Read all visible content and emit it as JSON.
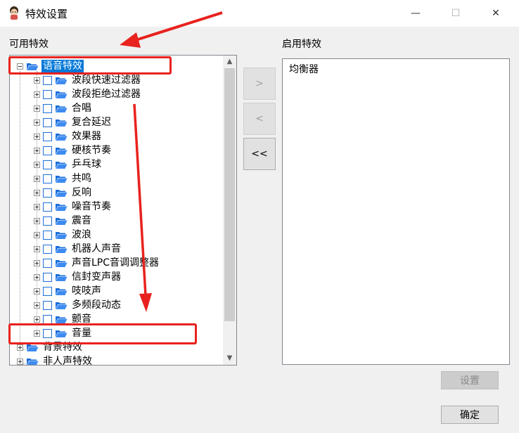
{
  "window": {
    "title": "特效设置",
    "minimize_glyph": "—",
    "maximize_glyph": "☐",
    "close_glyph": "✕"
  },
  "available_panel": {
    "label": "可用特效",
    "tree": {
      "voice_group": {
        "label": "语音特效",
        "children": [
          "波段快速过滤器",
          "波段拒绝过滤器",
          "合唱",
          "复合延迟",
          "效果器",
          "硬核节奏",
          "乒乓球",
          "共鸣",
          "反响",
          "噪音节奏",
          "震音",
          "波浪",
          "机器人声音",
          "声音LPC音调调整器",
          "信封变声器",
          "吱吱声",
          "多频段动态",
          "颤音",
          "音量"
        ]
      },
      "background_group": {
        "label": "背景特效"
      },
      "nonhuman_group": {
        "label": "非人声特效"
      }
    },
    "scroll_up_glyph": "▲",
    "scroll_down_glyph": "▼"
  },
  "transfer_buttons": {
    "add_label": ">",
    "remove_label": "<",
    "remove_all_label": "<<"
  },
  "enabled_panel": {
    "label": "启用特效",
    "items": [
      "均衡器"
    ]
  },
  "buttons": {
    "settings_label": "设置",
    "ok_label": "确定"
  },
  "colors": {
    "selection": "#0078d7",
    "annotation": "#e8221e",
    "folder": "#1e6fd9"
  }
}
